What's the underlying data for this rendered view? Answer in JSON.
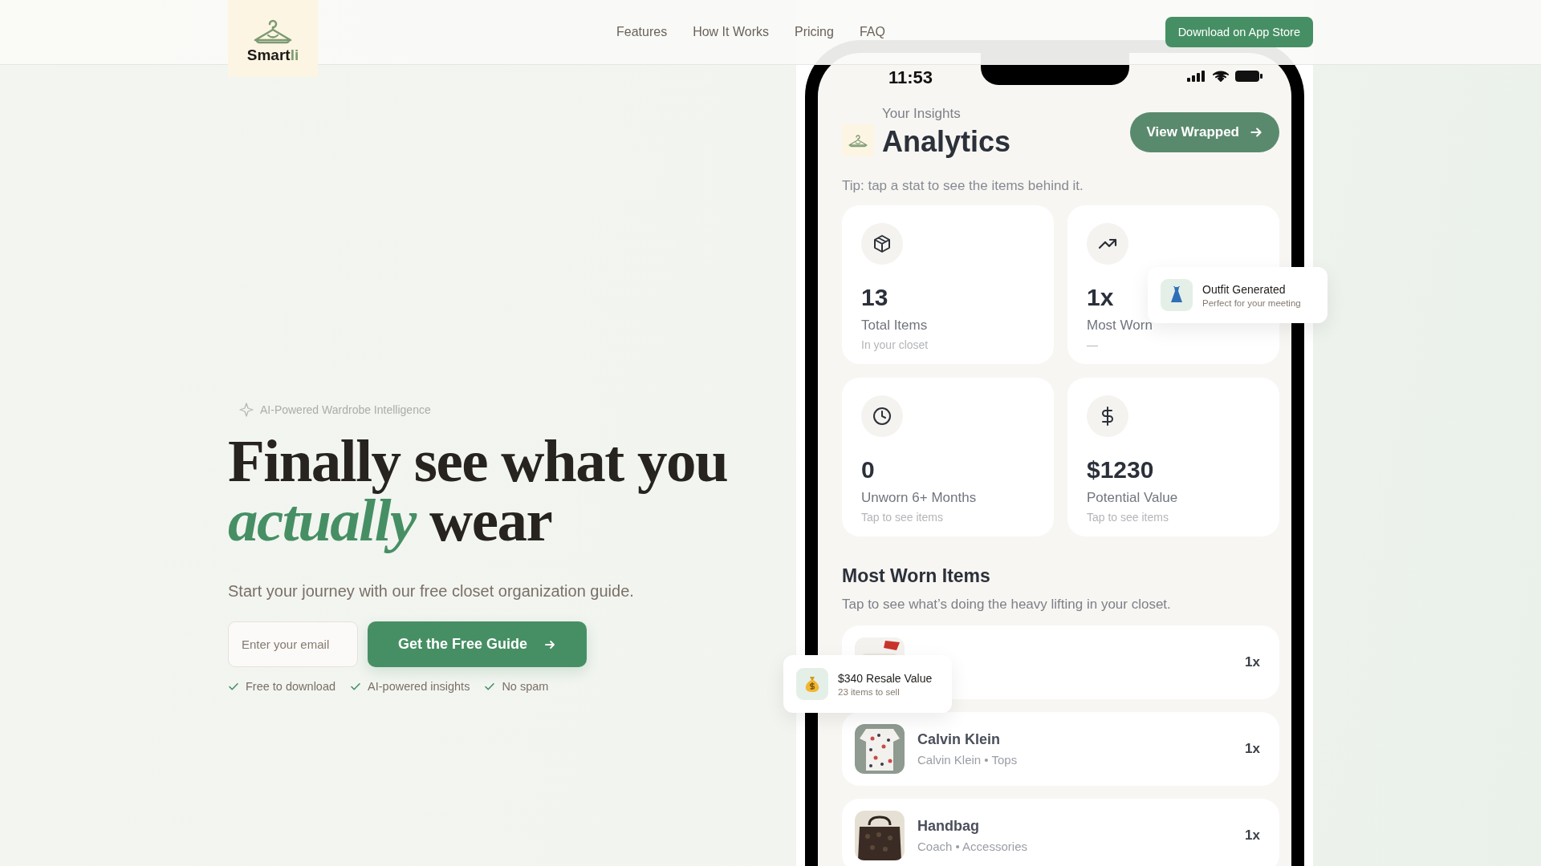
{
  "header": {
    "logo": {
      "parts": [
        {
          "text": "Smart",
          "accent": false
        },
        {
          "text": "li",
          "accent": true
        }
      ]
    },
    "nav": [
      {
        "label": "Features"
      },
      {
        "label": "How It Works"
      },
      {
        "label": "Pricing"
      },
      {
        "label": "FAQ"
      }
    ],
    "cta": "Download on App Store"
  },
  "hero": {
    "badge": "AI-Powered Wardrobe Intelligence",
    "headline": "Finally see what you *actually* wear",
    "subtitle": "Start your journey with our free closet organization guide.",
    "email": {
      "placeholder": "Enter your email"
    },
    "button": "Get the Free Guide",
    "checks": [
      {
        "label": "Free to download"
      },
      {
        "label": "AI-powered insights"
      },
      {
        "label": "No spam"
      }
    ]
  },
  "phone": {
    "time": "11:53",
    "eyebrow": "Your Insights",
    "title": "Analytics",
    "button": "View Wrapped",
    "tip": "Tip: tap a stat to see the items behind it.",
    "stats": [
      {
        "kind": "box",
        "value": "13",
        "label": "Total Items",
        "sub": "In your closet"
      },
      {
        "kind": "trend",
        "value": "1x",
        "label": "Most Worn",
        "sub": "—"
      },
      {
        "kind": "clock",
        "value": "0",
        "label": "Unworn 6+ Months",
        "sub": "Tap to see items"
      },
      {
        "kind": "dollar",
        "value": "$1230",
        "label": "Potential Value",
        "sub": "Tap to see items"
      }
    ],
    "section_title": "Most Worn Items",
    "section_sub": "Tap to see what’s doing the heavy lifting in your closet.",
    "items": [
      {
        "kind": "red",
        "count": "1x"
      },
      {
        "kind": "floral",
        "name": "Calvin Klein",
        "sub": "Calvin Klein • Tops",
        "count": "1x"
      },
      {
        "kind": "bag",
        "name": "Handbag",
        "sub": "Coach • Accessories",
        "count": "1x"
      }
    ]
  },
  "toasts": [
    {
      "kind": "dress",
      "title": "Outfit Generated",
      "sub": "Perfect for your meeting"
    },
    {
      "kind": "money",
      "title": "$340 Resale Value",
      "sub": "23 items to sell"
    }
  ]
}
